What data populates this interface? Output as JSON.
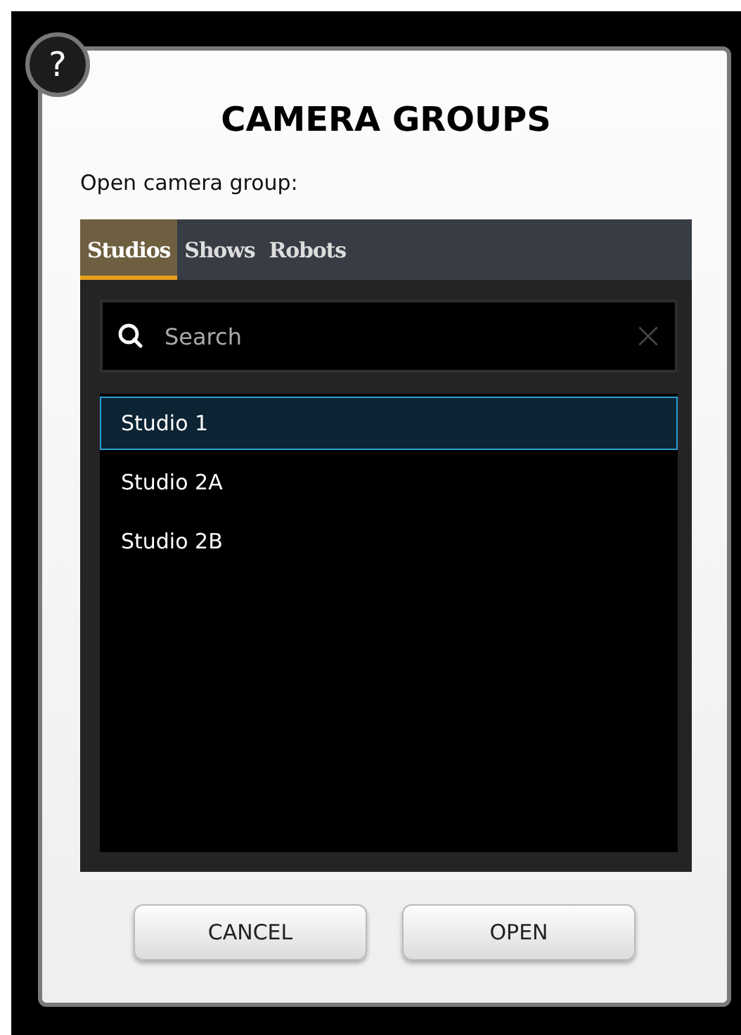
{
  "dialog": {
    "help": "?",
    "title": "CAMERA GROUPS",
    "prompt": "Open camera group:"
  },
  "tabs": [
    {
      "label": "Studios",
      "selected": true
    },
    {
      "label": "Shows",
      "selected": false
    },
    {
      "label": "Robots",
      "selected": false
    }
  ],
  "search": {
    "placeholder": "Search"
  },
  "items": [
    {
      "label": "Studio 1",
      "selected": true
    },
    {
      "label": "Studio 2A",
      "selected": false
    },
    {
      "label": "Studio 2B",
      "selected": false
    }
  ],
  "buttons": [
    "CANCEL",
    "OPEN"
  ]
}
